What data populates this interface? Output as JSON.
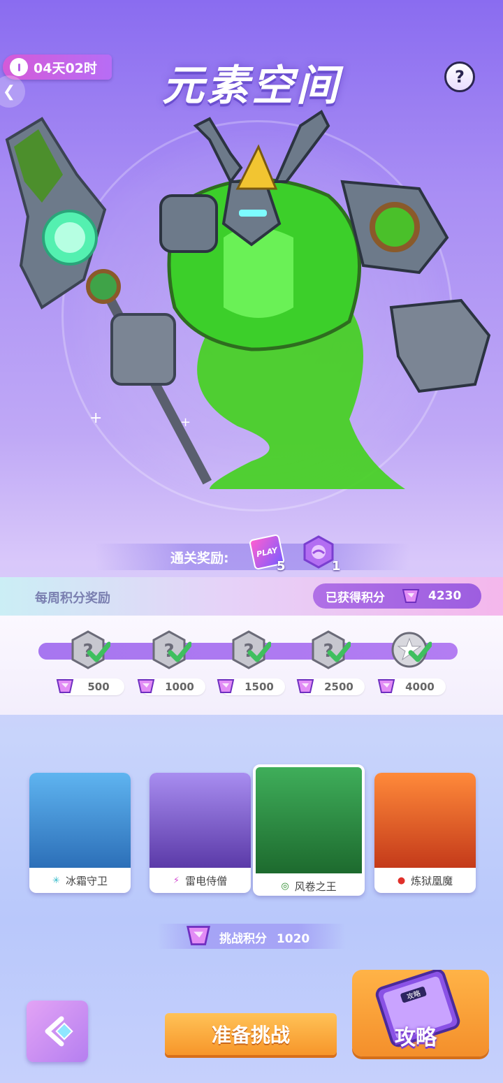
{
  "header": {
    "timer": "04天02时",
    "title": "元素空间",
    "help": "?"
  },
  "reward": {
    "label": "通关奖励:",
    "ticket_text": "PLAY",
    "ticket_count": "5",
    "gem_count": "1"
  },
  "weekly": {
    "title": "每周积分奖励",
    "earned_label": "已获得积分",
    "earned_value": "4230",
    "progress_fraction": 1.0,
    "milestones": [
      {
        "points": "500",
        "claimed": true
      },
      {
        "points": "1000",
        "claimed": true
      },
      {
        "points": "1500",
        "claimed": true
      },
      {
        "points": "2500",
        "claimed": true
      },
      {
        "points": "4000",
        "claimed": true
      }
    ]
  },
  "bosses": [
    {
      "name": "冰霜守卫",
      "icon": "snowflake-icon",
      "selected": false
    },
    {
      "name": "雷电侍僧",
      "icon": "lightning-icon",
      "selected": false
    },
    {
      "name": "风卷之王",
      "icon": "wind-icon",
      "selected": true
    },
    {
      "name": "炼狱凰魔",
      "icon": "fire-icon",
      "selected": false
    }
  ],
  "challenge": {
    "label": "挑战积分",
    "value": "1020"
  },
  "buttons": {
    "start": "准备挑战",
    "guide": "攻略",
    "guide_book": "攻略"
  },
  "colors": {
    "accent_purple": "#9d5ee0",
    "button_orange": "#f7962a",
    "check_green": "#3fbf5f"
  }
}
